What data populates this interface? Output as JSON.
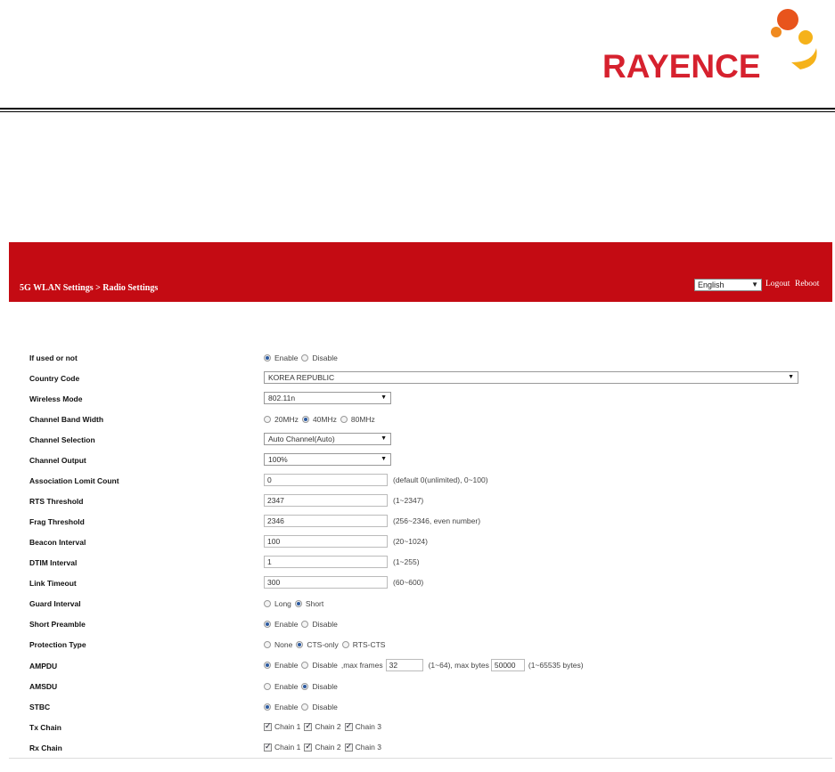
{
  "brand": {
    "name": "RAYENCE",
    "accent": "#d6212e",
    "orb_colors": [
      "#e8541c",
      "#f5b21a"
    ]
  },
  "topbar": {
    "breadcrumb": "5G WLAN Settings > Radio Settings",
    "language": "English",
    "logout": "Logout",
    "reboot": "Reboot",
    "bar_color": "#c40b13"
  },
  "fields": {
    "if_used": {
      "label": "If used or not",
      "options": [
        "Enable",
        "Disable"
      ],
      "selected": "Enable"
    },
    "country_code": {
      "label": "Country Code",
      "value": "KOREA REPUBLIC"
    },
    "wireless_mode": {
      "label": "Wireless Mode",
      "value": "802.11n"
    },
    "channel_bw": {
      "label": "Channel Band Width",
      "options": [
        "20MHz",
        "40MHz",
        "80MHz"
      ],
      "selected": "40MHz"
    },
    "channel_selection": {
      "label": "Channel Selection",
      "value": "Auto Channel(Auto)"
    },
    "channel_output": {
      "label": "Channel Output",
      "value": "100%"
    },
    "assoc_limit": {
      "label": "Association Lomit Count",
      "value": "0",
      "hint": "(default 0(unlimited), 0~100)"
    },
    "rts": {
      "label": "RTS Threshold",
      "value": "2347",
      "hint": "(1~2347)"
    },
    "frag": {
      "label": "Frag Threshold",
      "value": "2346",
      "hint": "(256~2346, even number)"
    },
    "beacon": {
      "label": "Beacon Interval",
      "value": "100",
      "hint": "(20~1024)"
    },
    "dtim": {
      "label": "DTIM Interval",
      "value": "1",
      "hint": "(1~255)"
    },
    "link_timeout": {
      "label": "Link Timeout",
      "value": "300",
      "hint": "(60~600)"
    },
    "guard": {
      "label": "Guard Interval",
      "options": [
        "Long",
        "Short"
      ],
      "selected": "Short"
    },
    "preamble": {
      "label": "Short Preamble",
      "options": [
        "Enable",
        "Disable"
      ],
      "selected": "Enable"
    },
    "protection": {
      "label": "Protection Type",
      "options": [
        "None",
        "CTS-only",
        "RTS-CTS"
      ],
      "selected": "CTS-only"
    },
    "ampdu": {
      "label": "AMPDU",
      "options": [
        "Enable",
        "Disable"
      ],
      "selected": "Enable",
      "frames_label": ",max frames",
      "frames_value": "32",
      "frames_hint": "(1~64), max bytes",
      "bytes_value": "50000",
      "bytes_hint": "(1~65535 bytes)"
    },
    "amsdu": {
      "label": "AMSDU",
      "options": [
        "Enable",
        "Disable"
      ],
      "selected": "Disable"
    },
    "stbc": {
      "label": "STBC",
      "options": [
        "Enable",
        "Disable"
      ],
      "selected": "Enable"
    },
    "tx_chain": {
      "label": "Tx Chain",
      "options": [
        "Chain 1",
        "Chain 2",
        "Chain 3"
      ],
      "checked": [
        true,
        true,
        true
      ]
    },
    "rx_chain": {
      "label": "Rx Chain",
      "options": [
        "Chain 1",
        "Chain 2",
        "Chain 3"
      ],
      "checked": [
        true,
        true,
        true
      ]
    }
  }
}
